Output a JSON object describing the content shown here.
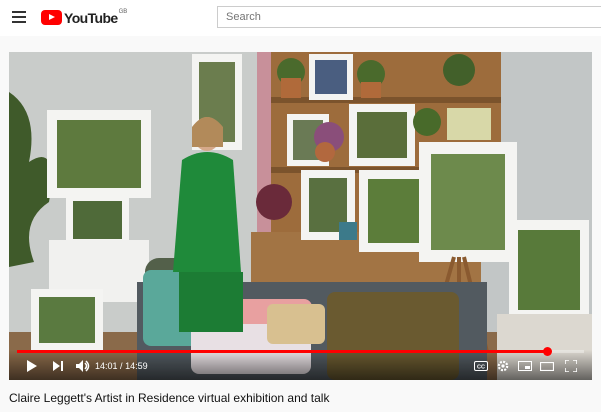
{
  "header": {
    "logo_text": "YouTube",
    "logo_region": "GB",
    "menu_icon": "hamburger-menu-icon",
    "search_placeholder": "Search"
  },
  "player": {
    "current_time": "14:01",
    "duration": "14:59",
    "progress_fraction": 0.9355,
    "colors": {
      "progress": "#ff0000"
    },
    "controls": [
      "play-icon",
      "next-icon",
      "volume-icon",
      "subtitles-icon",
      "settings-icon",
      "miniplayer-icon",
      "theater-mode-icon",
      "fullscreen-icon"
    ]
  },
  "video": {
    "title": "Claire Leggett's Artist in Residence virtual exhibition and talk"
  }
}
